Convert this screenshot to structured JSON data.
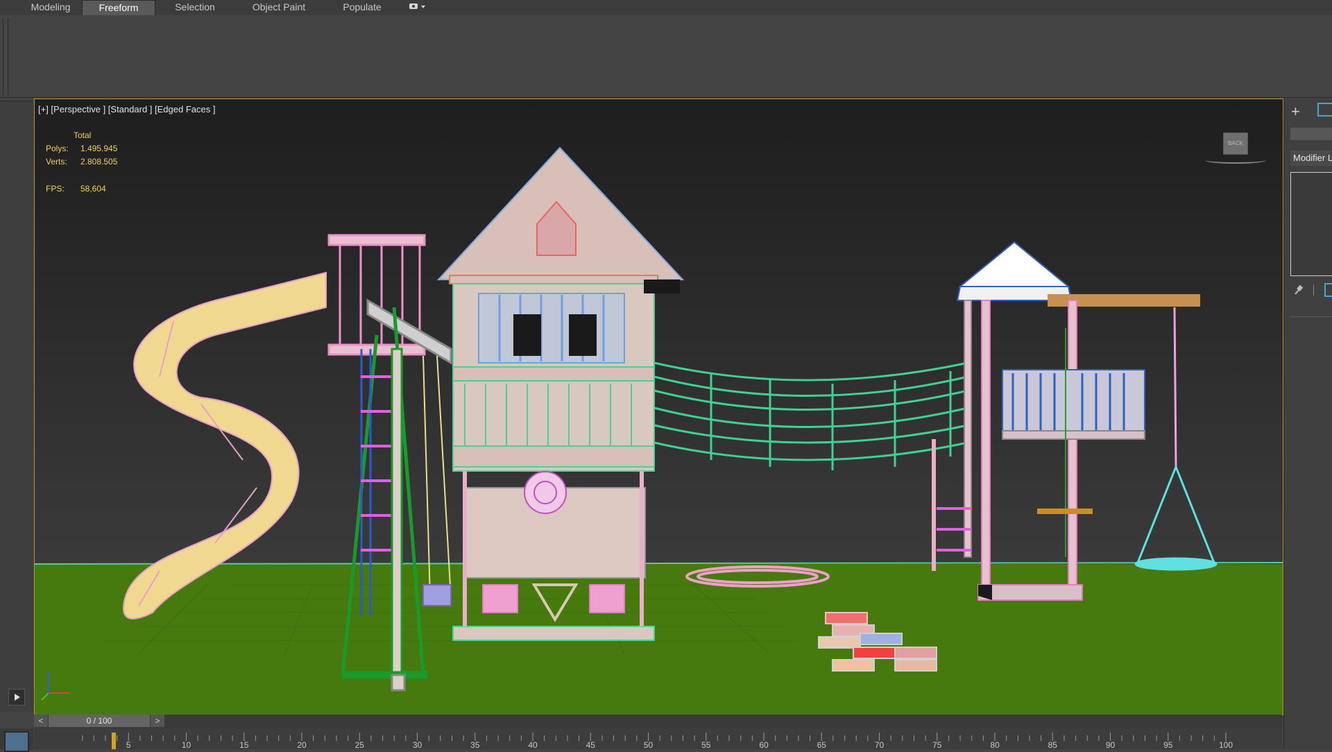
{
  "ribbon": {
    "tabs": [
      {
        "label": "Modeling",
        "active": false
      },
      {
        "label": "Freeform",
        "active": true
      },
      {
        "label": "Selection",
        "active": false
      },
      {
        "label": "Object Paint",
        "active": false
      },
      {
        "label": "Populate",
        "active": false
      }
    ],
    "display_toggle_icon": "eye-dropdown-icon"
  },
  "viewport": {
    "label": "[+] [Perspective ] [Standard ] [Edged Faces ]",
    "stats": {
      "total_label": "Total",
      "polys_label": "Polys:",
      "polys_value": "1.495.945",
      "verts_label": "Verts:",
      "verts_value": "2.808.505",
      "fps_label": "FPS:",
      "fps_value": "58,604"
    },
    "viewcube_label": "BACK",
    "colors": {
      "ground": "#4a7a0c",
      "background": "#2d2d2d",
      "border": "#b8962a",
      "stats_text": "#f2d15a"
    }
  },
  "command_panel": {
    "modifier_list_label": "Modifier Li"
  },
  "timeline": {
    "slider_text": "0 / 100",
    "prev_label": "<",
    "next_label": ">",
    "ticks": [
      "5",
      "10",
      "15",
      "20",
      "25",
      "30",
      "35",
      "40",
      "45",
      "50",
      "55",
      "60",
      "65",
      "70",
      "75",
      "80",
      "85",
      "90",
      "95",
      "100"
    ]
  }
}
